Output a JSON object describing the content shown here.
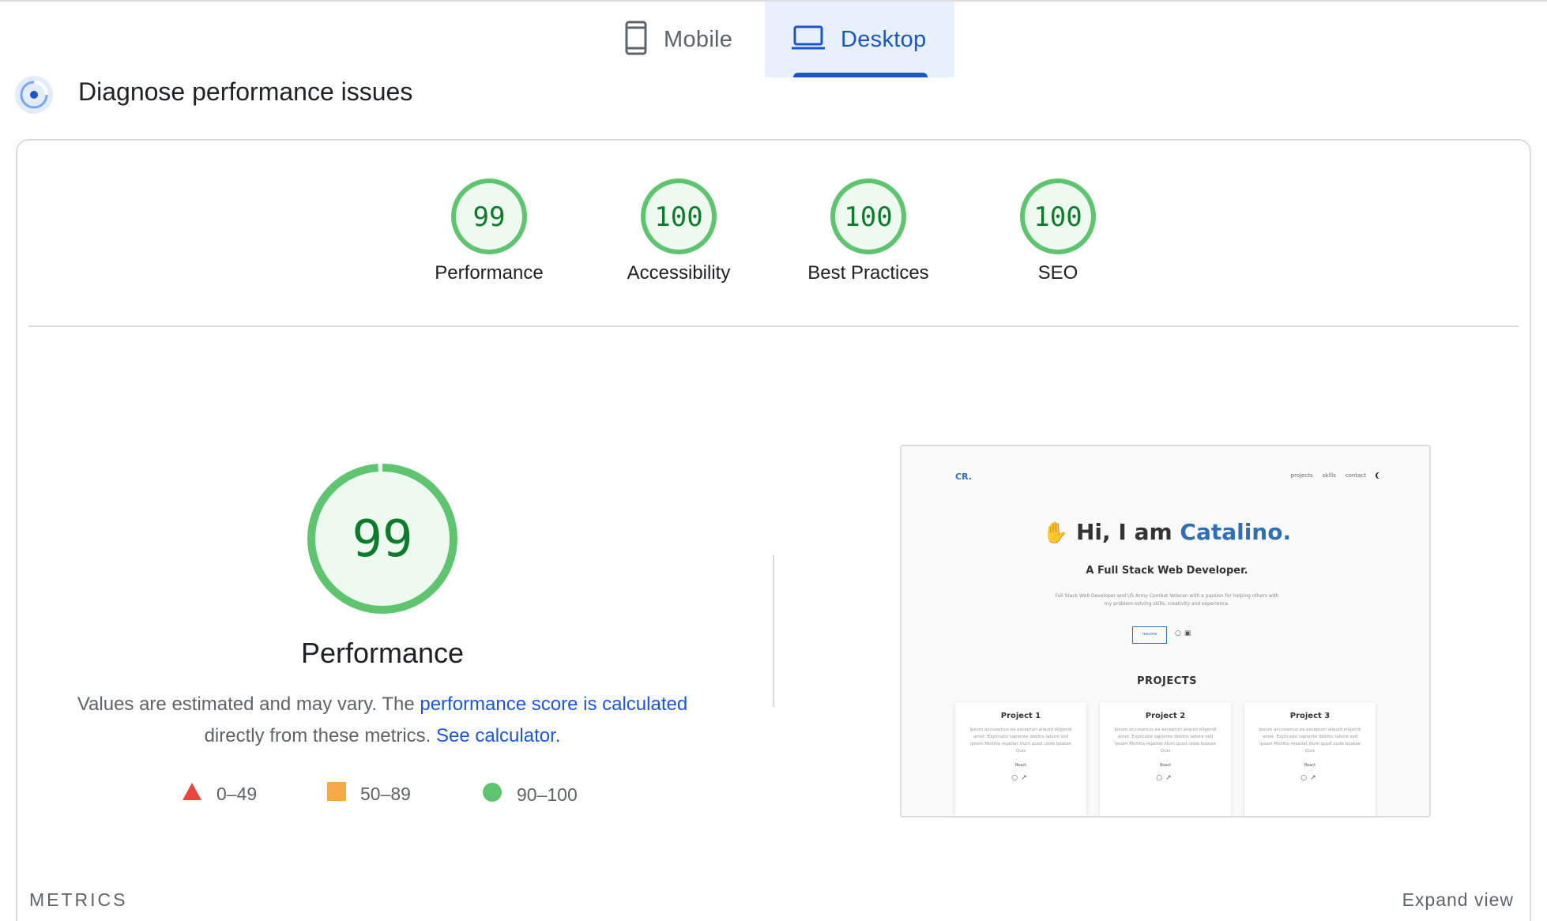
{
  "tabs": [
    {
      "label": "Mobile",
      "icon": "mobile-phone-icon",
      "selected": false
    },
    {
      "label": "Desktop",
      "icon": "laptop-icon",
      "selected": true
    }
  ],
  "header": {
    "title": "Diagnose performance issues",
    "icon": "gauge-icon"
  },
  "scores": [
    {
      "value": "99",
      "label": "Performance"
    },
    {
      "value": "100",
      "label": "Accessibility"
    },
    {
      "value": "100",
      "label": "Best Practices"
    },
    {
      "value": "100",
      "label": "SEO"
    }
  ],
  "performance": {
    "score": "99",
    "score_fraction": 0.99,
    "title": "Performance",
    "desc_prefix": "Values are estimated and may vary. The ",
    "desc_link1": "performance score is calculated",
    "desc_middle": " directly from these metrics. ",
    "desc_link2": "See calculator."
  },
  "legend": [
    {
      "shape": "triangle",
      "range": "0–49",
      "color": "#e8453c"
    },
    {
      "shape": "square",
      "range": "50–89",
      "color": "#f4a94a"
    },
    {
      "shape": "circle",
      "range": "90–100",
      "color": "#5ec470"
    }
  ],
  "metrics": {
    "label": "METRICS",
    "expand": "Expand view"
  },
  "preview": {
    "logo": "CR.",
    "nav": [
      "projects",
      "skills",
      "contact"
    ],
    "hero_prefix": "Hi, I am ",
    "hero_name": "Catalino.",
    "subtitle": "A Full Stack Web Developer.",
    "description": "Full Stack Web Developer and US Army Combat Veteran with a passion for helping others with my problem-solving skills, creativity and experience.",
    "resume_label": "resume",
    "projects_heading": "PROJECTS",
    "projects": [
      {
        "title": "Project 1",
        "text": "Ipsum accusamus ea excepturi aliquid eligendi amet. Explicabo sapiente debitis labore sed ipsam Mollitia repellat illum quod unde beatae Quis",
        "stack": "React"
      },
      {
        "title": "Project 2",
        "text": "Ipsum accusamus ea excepturi aliquid eligendi amet. Explicabo sapiente debitis labore sed ipsam Mollitia repellat illum quod unde beatae Quis",
        "stack": "React"
      },
      {
        "title": "Project 3",
        "text": "Ipsum accusamus ea excepturi aliquid eligendi amet. Explicabo sapiente debitis labore sed ipsam Mollitia repellat illum quod unde beatae Quis",
        "stack": "React"
      }
    ]
  },
  "colors": {
    "pass": "#5ec470",
    "pass_bg": "#eefaf0",
    "score_text": "#0d7a2c",
    "accent": "#1a56c4",
    "link": "#1a56db"
  }
}
